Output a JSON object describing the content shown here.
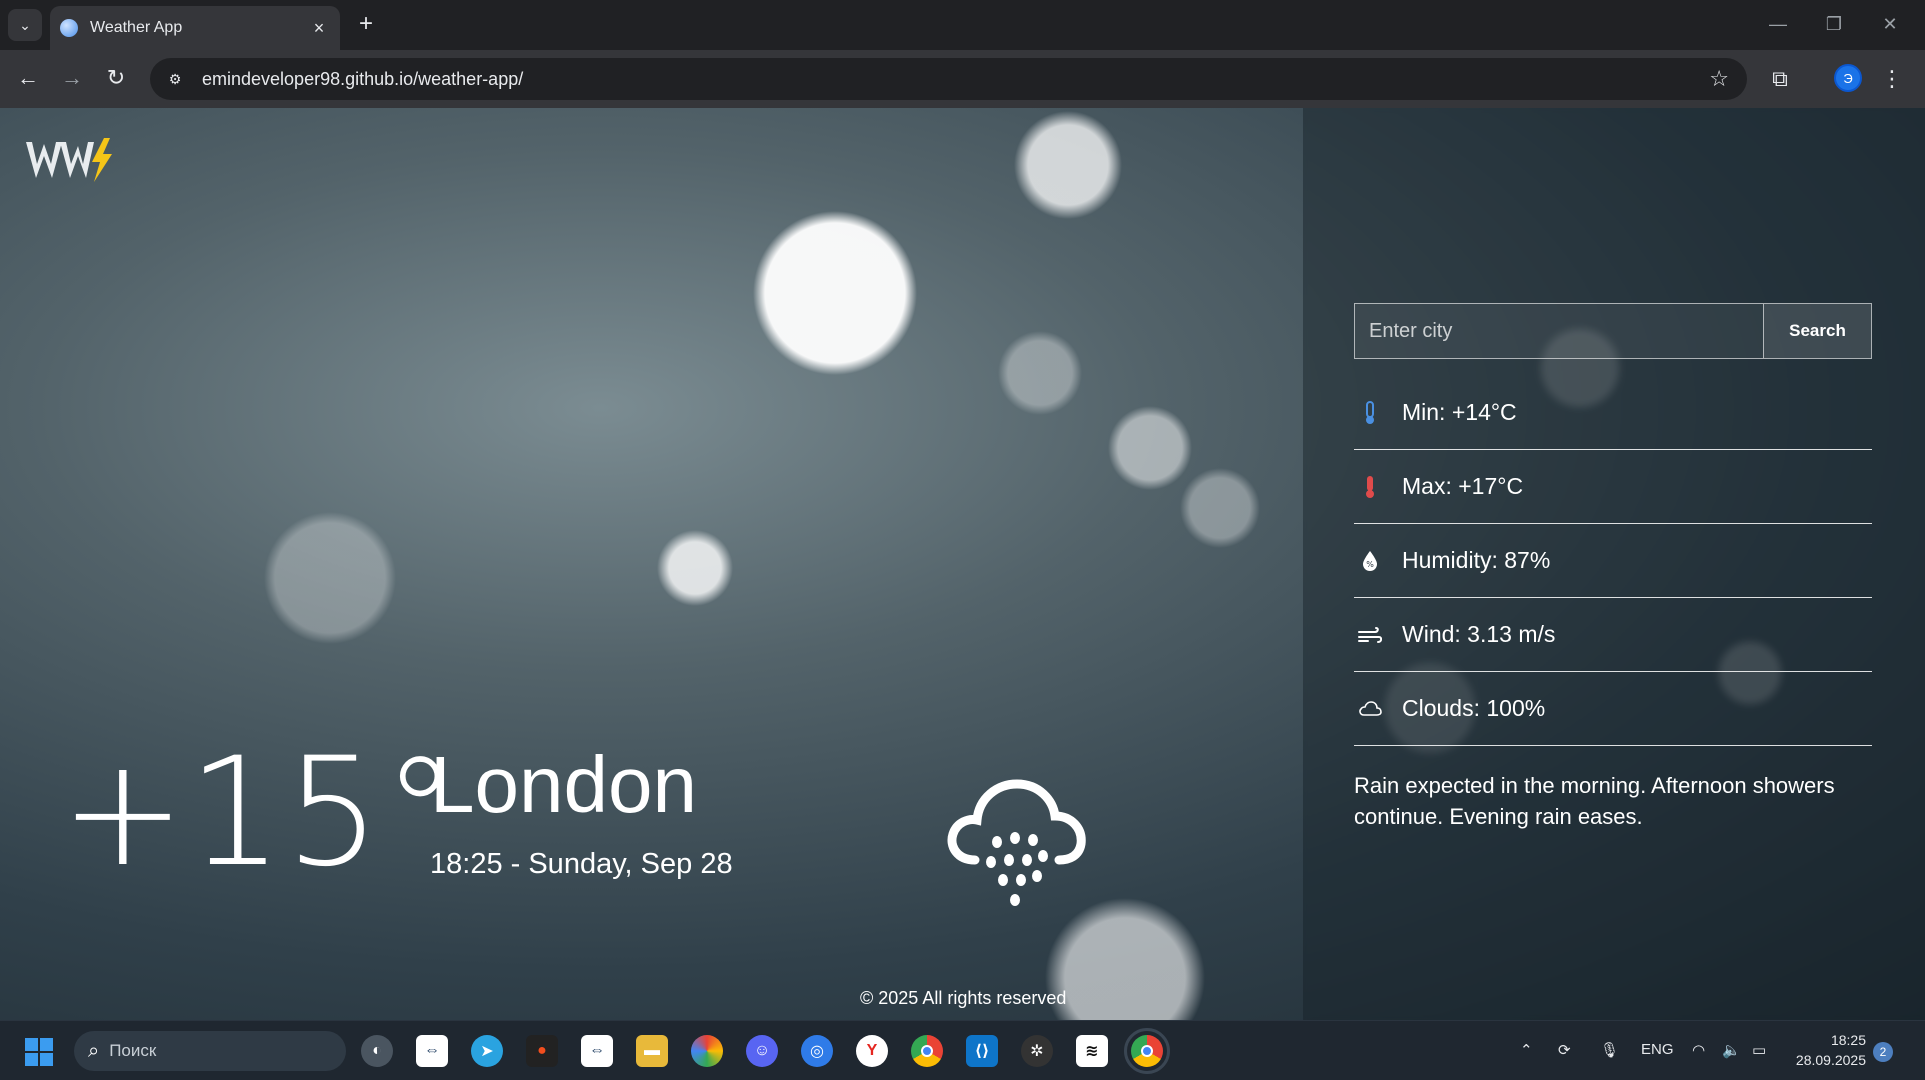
{
  "browser": {
    "tab_title": "Weather App",
    "url": "emindeveloper98.github.io/weather-app/",
    "profile_initial": "Э"
  },
  "app": {
    "temperature": "+15°",
    "city": "London",
    "datetime": "18:25 - Sunday, Sep 28",
    "weather_icon": "rain-cloud-icon",
    "footer": "© 2025 All rights reserved",
    "search": {
      "placeholder": "Enter city",
      "button_label": "Search"
    },
    "stats": [
      {
        "icon": "thermometer-cold-icon",
        "label": "Min: +14°C"
      },
      {
        "icon": "thermometer-hot-icon",
        "label": "Max: +17°C"
      },
      {
        "icon": "humidity-icon",
        "label": "Humidity: 87%"
      },
      {
        "icon": "wind-icon",
        "label": "Wind: 3.13 m/s"
      },
      {
        "icon": "cloud-icon",
        "label": "Clouds: 100%"
      }
    ],
    "description": "Rain expected in the morning. Afternoon showers continue. Evening rain eases."
  },
  "taskbar": {
    "search_placeholder": "Поиск",
    "lang": "ENG",
    "time": "18:25",
    "date": "28.09.2025",
    "notifications": "2"
  },
  "colors": {
    "accent_logo": "#f5c518",
    "min_icon": "#4a90e2",
    "max_icon": "#e04b4b"
  }
}
